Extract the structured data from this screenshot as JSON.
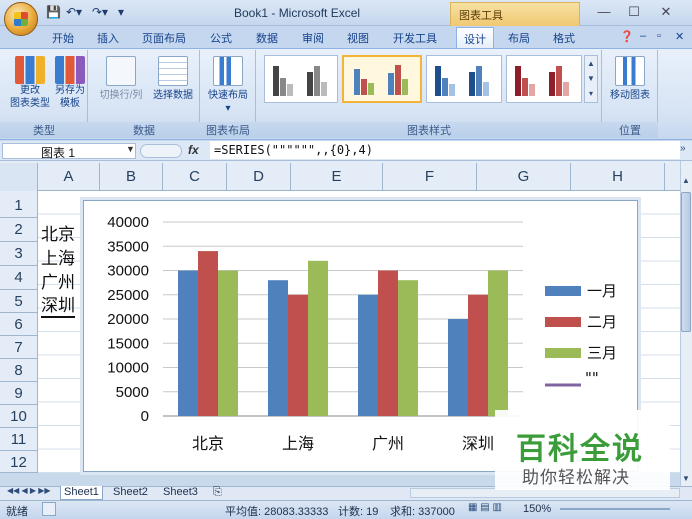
{
  "titlebar": {
    "title": "Book1 - Microsoft Excel",
    "contextual_tab": "图表工具",
    "minimize": "—",
    "maximize": "☐",
    "close": "✕"
  },
  "tabs": [
    "开始",
    "插入",
    "页面布局",
    "公式",
    "数据",
    "审阅",
    "视图",
    "开发工具",
    "设计",
    "布局",
    "格式"
  ],
  "ribbon": {
    "change_type_label": "更改\n图表类型",
    "save_template_label": "另存为\n模板",
    "switch_rowcol_label": "切换行/列",
    "select_data_label": "选择数据",
    "quick_layout_label": "快速布局",
    "move_chart_label": "移动图表",
    "groups": {
      "type": "类型",
      "data": "数据",
      "layout": "图表布局",
      "styles": "图表样式",
      "location": "位置"
    }
  },
  "formula_bar": {
    "name_box": "图表 1",
    "fx": "fx",
    "formula": "=SERIES(\"\"\"\"\"\",,{0},4)"
  },
  "columns": [
    "A",
    "B",
    "C",
    "D",
    "E",
    "F",
    "G",
    "H"
  ],
  "rows": [
    "1",
    "2",
    "3",
    "4",
    "5",
    "6",
    "7",
    "8",
    "9",
    "10",
    "11",
    "12"
  ],
  "cells": {
    "a2": "北京",
    "a3": "上海",
    "a4": "广州",
    "a5": "深圳"
  },
  "chart_data": {
    "type": "bar",
    "categories": [
      "北京",
      "上海",
      "广州",
      "深圳"
    ],
    "series": [
      {
        "name": "一月",
        "color": "#4f81bd",
        "values": [
          30000,
          28000,
          25000,
          20000
        ]
      },
      {
        "name": "二月",
        "color": "#c0504d",
        "values": [
          34000,
          25000,
          30000,
          25000
        ]
      },
      {
        "name": "三月",
        "color": "#9bbb59",
        "values": [
          30000,
          32000,
          28000,
          30000
        ]
      }
    ],
    "extra_legend": {
      "name": "\"\"",
      "color": "#8064a2"
    },
    "ylim": [
      0,
      40000
    ],
    "yticks": [
      "0",
      "5000",
      "10000",
      "15000",
      "20000",
      "25000",
      "30000",
      "35000",
      "40000"
    ],
    "grid": true,
    "legend": "right"
  },
  "sheet_tabs": [
    "Sheet1",
    "Sheet2",
    "Sheet3"
  ],
  "status": {
    "ready": "就绪",
    "average": "平均值: 28083.33333",
    "count": "计数: 19",
    "sum": "求和: 337000",
    "zoom": "150%"
  },
  "watermark": {
    "title": "百科全说",
    "subtitle": "助你轻松解决"
  },
  "colors": {
    "accent": "#15428b",
    "ribbon_bg": "#d7e4f4"
  }
}
